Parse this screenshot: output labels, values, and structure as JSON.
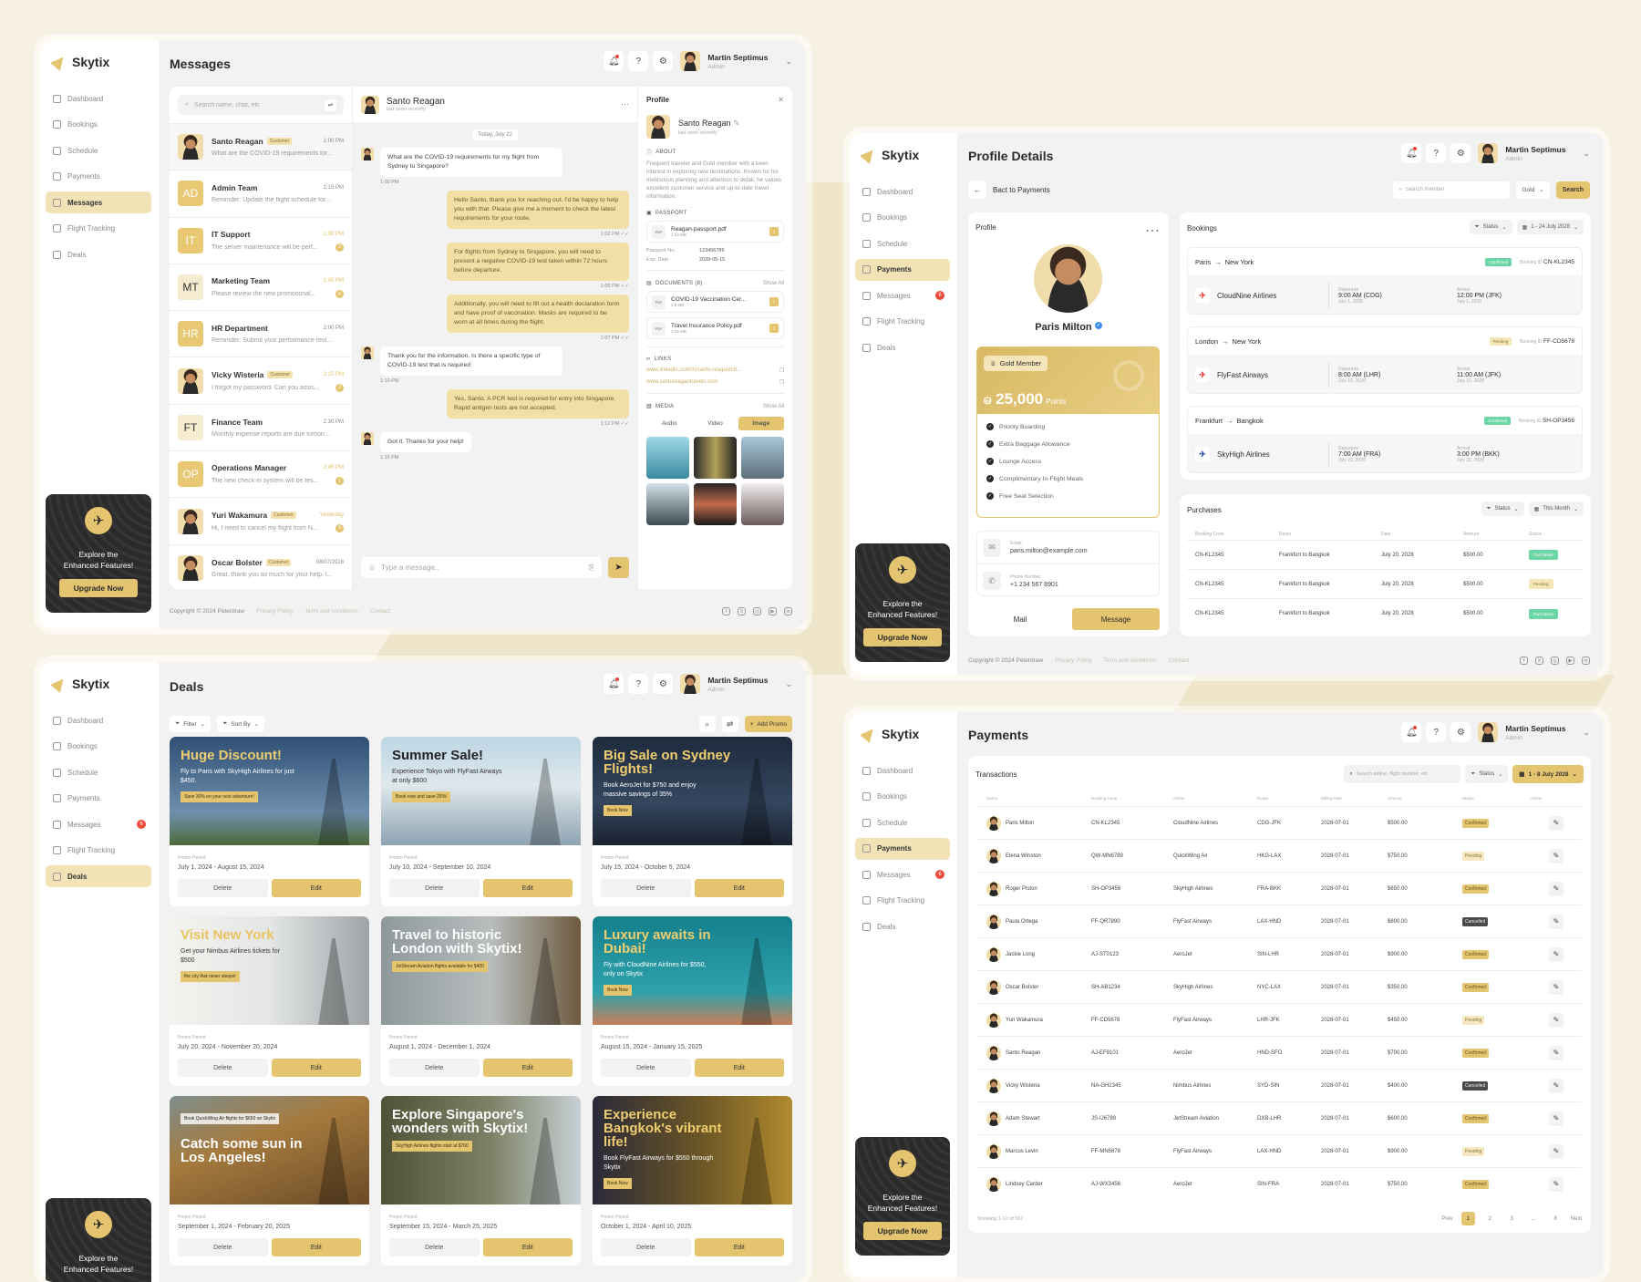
{
  "brand": "Skytix",
  "user": {
    "name": "Martin Septimus",
    "role": "Admin"
  },
  "nav": [
    "Dashboard",
    "Bookings",
    "Schedule",
    "Payments",
    "Messages",
    "Flight Tracking",
    "Deals"
  ],
  "messages_badge": "6",
  "promo": {
    "text": "Explore the Enhanced Features!",
    "button": "Upgrade Now"
  },
  "footer": {
    "copyright": "Copyright © 2024 Peterdraw",
    "links": [
      "Privacy Policy",
      "Term and conditions",
      "Contact"
    ],
    "social": [
      "facebook-icon",
      "x-icon",
      "instagram-icon",
      "youtube-icon",
      "linkedin-icon"
    ]
  },
  "colors": {
    "accent": "#e5c46f",
    "accent_light": "#f2e3b6",
    "confirmed": "#6cd6a6",
    "cancelled": "#4a4a4a",
    "background": "#f6f1e2"
  },
  "messages_page": {
    "title": "Messages",
    "search_placeholder": "Search name, chat, etc",
    "conversations": [
      {
        "name": "Santo Reagan",
        "tag": "Customer",
        "time": "1:00 PM",
        "preview": "What are the COVID-19 requirements for...",
        "avatar": "photo",
        "active": true
      },
      {
        "name": "Admin Team",
        "initials": "AD",
        "style": "gold",
        "time": "1:15 PM",
        "preview": "Reminder: Update the flight schedule for..."
      },
      {
        "name": "IT Support",
        "initials": "IT",
        "style": "gold",
        "time": "1:30 PM",
        "highlight": true,
        "preview": "The server maintenance will be perf...",
        "unread": "3"
      },
      {
        "name": "Marketing Team",
        "initials": "MT",
        "style": "light",
        "time": "1:45 PM",
        "highlight": true,
        "preview": "Please review the new promotional...",
        "unread": "6"
      },
      {
        "name": "HR Department",
        "initials": "HR",
        "style": "gold",
        "time": "2:00 PM",
        "preview": "Reminder: Submit your performance revi..."
      },
      {
        "name": "Vicky Wisteria",
        "tag": "Customer",
        "time": "2:15 PM",
        "highlight": true,
        "preview": "I forgot my password. Can you assis...",
        "unread": "2",
        "avatar": "photo"
      },
      {
        "name": "Finance Team",
        "initials": "FT",
        "style": "light",
        "time": "2:30 PM",
        "preview": "Monthly expense reports are due tomorr..."
      },
      {
        "name": "Operations Manager",
        "initials": "OP",
        "style": "gold",
        "time": "2:45 PM",
        "highlight": true,
        "preview": "The new check-in system will be tes...",
        "unread": "1"
      },
      {
        "name": "Yuri Wakamura",
        "tag": "Customer",
        "time": "Yesterday",
        "highlight": true,
        "preview": "Hi, I need to cancel my flight from N...",
        "unread": "5",
        "avatar": "photo"
      },
      {
        "name": "Oscar Bolster",
        "tag": "Customer",
        "time": "08/07/2028",
        "preview": "Great, thank you so much for your help. I...",
        "avatar": "photo"
      }
    ],
    "chat": {
      "name": "Santo Reagan",
      "status": "last seen recently",
      "date": "Today, July 22",
      "input_placeholder": "Type a message..",
      "messages": [
        {
          "dir": "in",
          "text": "What are the COVID-19 requirements for my flight from Sydney to Singapore?",
          "time": "1:00 PM"
        },
        {
          "dir": "out",
          "text": "Hello Santo, thank you for reaching out. I'd be happy to help you with that. Please give me a moment to check the latest requirements for your route.",
          "time": "1:02 PM"
        },
        {
          "dir": "out",
          "text": "For flights from Sydney to Singapore, you will need to present a negative COVID-19 test taken within 72 hours before departure.",
          "time": "1:05 PM"
        },
        {
          "dir": "out",
          "text": "Additionally, you will need to fill out a health declaration form and have proof of vaccination. Masks are required to be worn at all times during the flight.",
          "time": "1:07 PM"
        },
        {
          "dir": "in",
          "text": "Thank you for the information. Is there a specific type of COVID-19 test that is required",
          "time": "1:10 PM"
        },
        {
          "dir": "out",
          "text": "Yes, Santo. A PCR test is required for entry into Singapore. Rapid antigen tests are not accepted.",
          "time": "1:12 PM"
        },
        {
          "dir": "in",
          "text": "Got it. Thanks for your help!",
          "time": "1:15 PM"
        }
      ]
    },
    "profile": {
      "title": "Profile",
      "name": "Santo Reagan",
      "status": "last seen recently",
      "about_label": "ABOUT",
      "about": "Frequent traveler and Gold member with a keen interest in exploring new destinations. Known for his meticulous planning and attention to detail, he values excellent customer service and up-to-date travel information.",
      "passport_label": "PASSPORT",
      "passport_file": {
        "name": "Reagan-passport.pdf",
        "size": "1.43 MB"
      },
      "passport_no_label": "Passport No.",
      "passport_no": "123456789",
      "exp_label": "Exp. Date",
      "exp": "2028-05-15",
      "documents_label": "DOCUMENTS (8)",
      "show_all": "Show All",
      "documents": [
        {
          "name": "COVID-19 Vaccination Cer...",
          "size": "2.5 MB"
        },
        {
          "name": "Travel Insurance Policy.pdf",
          "size": "3.15 MB"
        }
      ],
      "links_label": "LINKS",
      "links": [
        "www.linkedin.com/in/santo-reagannst...",
        "www.santoreagantravels.com"
      ],
      "media_label": "MEDIA",
      "media_tabs": [
        "Audio",
        "Video",
        "Image"
      ],
      "media_active": "Image"
    }
  },
  "profile_page": {
    "title": "Profile Details",
    "back_label": "Bact to Payments",
    "search_placeholder": "Search member",
    "tier_select": "Gold",
    "search_button": "Search",
    "profile_title": "Profile",
    "name": "Paris Milton",
    "membership": "Gold Member",
    "points": "25,000",
    "points_label": "Points",
    "benefits": [
      "Priority Boarding",
      "Extra Baggage Allowance",
      "Lounge Access",
      "Complimentary In-Flight Meals",
      "Free Seat Selection"
    ],
    "email_label": "Email",
    "email": "paris.milton@example.com",
    "phone_label": "Phone Number",
    "phone": "+1 234 567 8901",
    "mail_button": "Mail",
    "message_button": "Message",
    "bookings_title": "Bookings",
    "bookings_status": "Status",
    "bookings_range": "1 - 24 July 2028",
    "booking_id_label": "Booking ID",
    "departure_label": "Departure",
    "arrival_label": "Arrival",
    "bookings": [
      {
        "from": "Paris",
        "to": "New York",
        "status": "Confirmed",
        "id": "CN-KL2345",
        "airline": "CloudNine Airlines",
        "dep": "9:00 AM (CDG)",
        "dep_date": "July 1, 2028",
        "arr": "12:00 PM (JFK)",
        "arr_date": "July 1, 2028",
        "logo_color": "#e8403a"
      },
      {
        "from": "London",
        "to": "New York",
        "status": "Pending",
        "id": "FF-CD5678",
        "airline": "FlyFast Airways",
        "dep": "8:00 AM (LHR)",
        "dep_date": "July 10, 2028",
        "arr": "11:00 AM (JFK)",
        "arr_date": "July 10, 2028",
        "logo_color": "#e8403a"
      },
      {
        "from": "Frankfurt",
        "to": "Bangkok",
        "status": "Confirmed",
        "id": "SH-OP3456",
        "airline": "SkyHigh Airlines",
        "dep": "7:00 AM (FRA)",
        "dep_date": "July 20, 2028",
        "arr": "3:00 PM (BKK)",
        "arr_date": "July 20, 2028",
        "logo_color": "#2d4fb5"
      }
    ],
    "purchases_title": "Purchases",
    "purchases_status": "Status",
    "purchases_range": "This Month",
    "purchase_columns": [
      "Booking Code",
      "Route",
      "Date",
      "Amount",
      "Status"
    ],
    "purchases": [
      {
        "code": "CN-KL2345",
        "route": "Frankfurt to Bangkok",
        "date": "July 20, 2028",
        "amount": "$500.00",
        "status": "Purchased"
      },
      {
        "code": "CN-KL2345",
        "route": "Frankfurt to Bangkok",
        "date": "July 20, 2028",
        "amount": "$500.00",
        "status": "Pending"
      },
      {
        "code": "CN-KL2345",
        "route": "Frankfurt to Bangkok",
        "date": "July 20, 2028",
        "amount": "$500.00",
        "status": "Purchased"
      }
    ]
  },
  "deals_page": {
    "title": "Deals",
    "filter": "Filter",
    "sort": "Sort By",
    "add_promo": "Add Promo",
    "promo_period_label": "Promo Period",
    "delete_label": "Delete",
    "edit_label": "Edit",
    "deals": [
      {
        "title": "Huge Discount!",
        "subtitle": "Fly to Paris with SkyHigh Airlines for just $450.",
        "tag": "Save 30% on your next adventure!",
        "period": "July 1, 2024 - August 15, 2024",
        "bg": "linear-gradient(180deg,#2f4f74,#6f8fae 70%,#4d6a3a)",
        "title_color": "#f0cd6e",
        "text_color": "#ffffff"
      },
      {
        "title": "Summer Sale!",
        "subtitle": "Experience Tokyo with FlyFast Airways at only $600",
        "tag": "Book now and save 25%!",
        "period": "July 10, 2024 - September 10, 2024",
        "bg": "linear-gradient(180deg,#bcd6e4,#dfe8ec 45%,#8ea3b3)",
        "title_color": "#222222",
        "text_color": "#333333"
      },
      {
        "title": "Big Sale on Sydney Flights!",
        "subtitle": "Book AeroJet for $750 and enjoy massive savings of 35%",
        "tag": "Book Now",
        "period": "July 15, 2024 - October 5, 2024",
        "bg": "linear-gradient(180deg,#1e2a3c,#34475f 60%,#1b2330)",
        "title_color": "#f0cd6e",
        "text_color": "#ffffff"
      },
      {
        "title": "Visit New York",
        "subtitle": "Get your Nimbus Airlines tickets for $500",
        "tag": "the city that never sleeps!",
        "period": "July 20, 2024 - November 20, 2024",
        "bg": "linear-gradient(90deg,#f3f2ee,#e4e6e6 50%,#9ea3a6)",
        "title_color": "#e7c45f",
        "text_color": "#333333"
      },
      {
        "title": "Travel to historic London with Skytix!",
        "subtitle": "",
        "tag": "JetStream Aviation flights available for $400",
        "period": "August 1, 2024 - December 1, 2024",
        "bg": "linear-gradient(90deg,#8e989b,#b8bdbd 55%,#6d5a3f)",
        "title_color": "#ffffff",
        "text_color": "#ffffff"
      },
      {
        "title": "Luxury awaits in Dubai!",
        "subtitle": "Fly with CloudNine Airlines for $550, only on Skytix",
        "tag": "Book Now",
        "period": "August 15, 2024 - January 15, 2025",
        "bg": "linear-gradient(180deg,#13808c,#2fa2ab 70%,#c77f58)",
        "title_color": "#f0cd6e",
        "text_color": "#ffffff"
      },
      {
        "title": "Catch some sun in Los Angeles!",
        "subtitle": "Book QuickWing Air flights for $650 on Skytix",
        "tag": "",
        "period": "September 1, 2024 - February 20, 2025",
        "bg": "linear-gradient(160deg,#7f8e8c,#a57a3e 40%,#6b4b26)",
        "title_color": "#ffffff",
        "text_color": "#333333"
      },
      {
        "title": "Explore Singapore's wonders with Skytix!",
        "subtitle": "",
        "tag": "SkyHigh Airlines flights start at $700",
        "period": "September 15, 2024 - March 25, 2025",
        "bg": "linear-gradient(90deg,#4f5236,#7d8266 55%,#c8d0d6)",
        "title_color": "#ffffff",
        "text_color": "#ffffff"
      },
      {
        "title": "Experience Bangkok's vibrant life!",
        "subtitle": "Book FlyFast Airways for $550 through Skytix",
        "tag": "Book Now",
        "period": "October 1, 2024 - April 10, 2025",
        "bg": "linear-gradient(90deg,#2a2a38,#6d5726 55%,#b08a2e)",
        "title_color": "#f0cd6e",
        "text_color": "#ffffff"
      }
    ]
  },
  "payments_page": {
    "title": "Payments",
    "transactions_title": "Transactions",
    "search_placeholder": "Search airline, flight number, etc",
    "status_filter": "Status",
    "date_range": "1 - 8 July 2028",
    "columns": [
      "Name",
      "Booking Code",
      "Airline",
      "Route",
      "Billing Date",
      "Amount",
      "Status",
      "Action"
    ],
    "rows": [
      {
        "name": "Paris Milton",
        "code": "CN-KL2345",
        "airline": "CloudNine Airlines",
        "route": "CDG-JFK",
        "date": "2028-07-01",
        "amount": "$500.00",
        "status": "Confirmed"
      },
      {
        "name": "Elena Winston",
        "code": "QW-MN6789",
        "airline": "QuickWing Air",
        "route": "HKG-LAX",
        "date": "2028-07-01",
        "amount": "$750.00",
        "status": "Pending"
      },
      {
        "name": "Roger Piston",
        "code": "SH-OP3456",
        "airline": "SkyHigh Airlines",
        "route": "FRA-BKK",
        "date": "2028-07-01",
        "amount": "$650.00",
        "status": "Confirmed"
      },
      {
        "name": "Paula Ortega",
        "code": "FF-QR7890",
        "airline": "FlyFast Airways",
        "route": "LAX-HND",
        "date": "2028-07-01",
        "amount": "$800.00",
        "status": "Cancelled"
      },
      {
        "name": "Jackie Long",
        "code": "AJ-ST0123",
        "airline": "AeroJet",
        "route": "SIN-LHR",
        "date": "2028-07-01",
        "amount": "$900.00",
        "status": "Confirmed"
      },
      {
        "name": "Oscar Bolster",
        "code": "SH-AB1234",
        "airline": "SkyHigh Airlines",
        "route": "NYC-LAX",
        "date": "2028-07-01",
        "amount": "$350.00",
        "status": "Confirmed"
      },
      {
        "name": "Yuri Wakamura",
        "code": "FF-CD5678",
        "airline": "FlyFast Airways",
        "route": "LHR-JFK",
        "date": "2028-07-01",
        "amount": "$450.00",
        "status": "Pending"
      },
      {
        "name": "Santo Reagan",
        "code": "AJ-EF9101",
        "airline": "AeroJet",
        "route": "HND-SFO",
        "date": "2028-07-01",
        "amount": "$700.00",
        "status": "Confirmed"
      },
      {
        "name": "Vicky Wisteria",
        "code": "NA-GH2345",
        "airline": "Nimbus Airlines",
        "route": "SYD-SIN",
        "date": "2028-07-01",
        "amount": "$400.00",
        "status": "Cancelled"
      },
      {
        "name": "Adam Stewart",
        "code": "JS-IJ6789",
        "airline": "JetStream Aviation",
        "route": "DXB-LHR",
        "date": "2028-07-01",
        "amount": "$600.00",
        "status": "Confirmed"
      },
      {
        "name": "Marcus Levin",
        "code": "FF-MN5678",
        "airline": "FlyFast Airways",
        "route": "LAX-HND",
        "date": "2028-07-01",
        "amount": "$900.00",
        "status": "Pending"
      },
      {
        "name": "Lindsey Carder",
        "code": "AJ-WX3456",
        "airline": "AeroJet",
        "route": "SIN-FRA",
        "date": "2028-07-01",
        "amount": "$750.00",
        "status": "Confirmed"
      }
    ],
    "showing": "Showing 1-12 of 567",
    "prev": "Prev",
    "next": "Next",
    "pages": [
      "1",
      "2",
      "3",
      "...",
      "8"
    ],
    "current_page": "1"
  }
}
